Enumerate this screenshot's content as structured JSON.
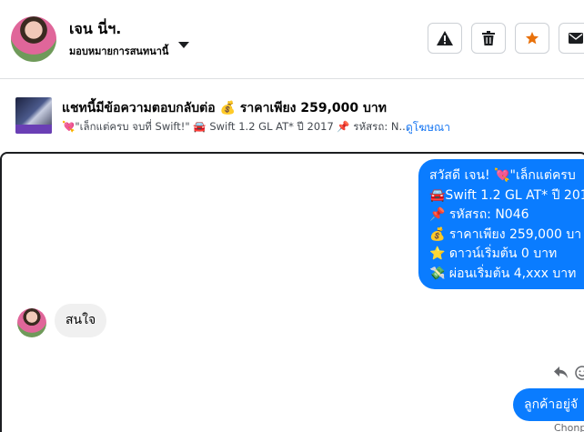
{
  "header": {
    "contact_name": "เจน นี่ฯ.",
    "assignee_label": "มอบหมายการสนทนานี้",
    "buttons": [
      {
        "name": "report-button",
        "icon": "warning-icon"
      },
      {
        "name": "delete-button",
        "icon": "trash-icon"
      },
      {
        "name": "star-button",
        "icon": "star-icon",
        "color": "#e8710a"
      },
      {
        "name": "mail-button",
        "icon": "envelope-icon"
      }
    ]
  },
  "ad": {
    "title": "แชทนี้มีข้อความตอบกลับต่อ 💰 ราคาเพียง 259,000 บาท",
    "description": "💘\"เล็กแต่ครบ จบที่ Swift!\" 🚘 Swift 1.2 GL AT* ปี 2017 📌 รหัสรถ: N...",
    "link": "ดูโฆษณา"
  },
  "messages": {
    "outgoing_1": [
      "สวัสดี เจน! 💘\"เล็กแต่ครบ",
      "🚘Swift 1.2 GL AT* ปี 201",
      "📌 รหัสรถ: N046",
      "💰 ราคาเพียง 259,000 บา",
      "⭐ ดาวน์เริ่มต้น 0 บาท",
      "💸 ผ่อนเริ่มต้น 4,xxx บาท"
    ],
    "incoming_1": "สนใจ",
    "outgoing_2": "ลูกค้าอยู่จั",
    "sender_label": "Chonp"
  },
  "colors": {
    "accent": "#0a7cff",
    "link": "#1877f2",
    "star": "#e8710a"
  }
}
